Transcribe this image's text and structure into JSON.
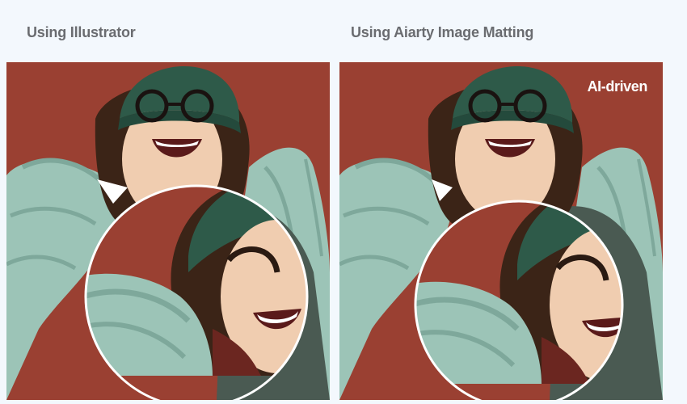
{
  "comparison": {
    "left": {
      "label": "Using Illustrator",
      "icon": "woman-portrait-icon"
    },
    "right": {
      "label": "Using Aiarty Image Matting",
      "badge": "AI-driven",
      "icon": "woman-portrait-icon"
    }
  },
  "colors": {
    "page_bg": "#f3f8fd",
    "label_text": "#6a6c70",
    "backdrop": "#9a4032",
    "jacket": "#9cc4b7",
    "beanie": "#2e5a49",
    "hair": "#3b2417",
    "skin": "#f0cdb0",
    "magnifier_ring": "#ffffff"
  }
}
